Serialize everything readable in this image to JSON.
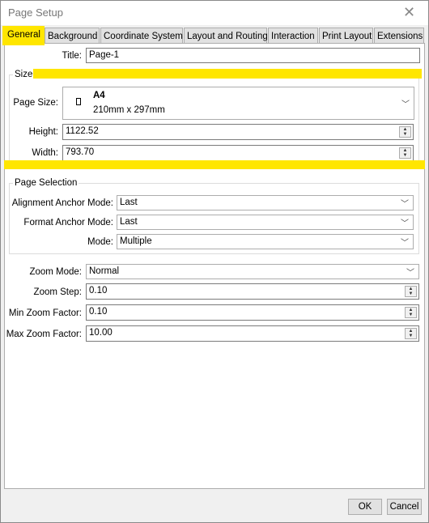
{
  "window": {
    "title": "Page Setup",
    "highlight_color": "#ffe600"
  },
  "tabs": [
    {
      "label": "General",
      "active": true
    },
    {
      "label": "Background"
    },
    {
      "label": "Coordinate System"
    },
    {
      "label": "Layout and Routing"
    },
    {
      "label": "Interaction"
    },
    {
      "label": "Print Layout"
    },
    {
      "label": "Extensions"
    }
  ],
  "general": {
    "title_label": "Title:",
    "title_value": "Page-1",
    "size": {
      "group_label": "Size",
      "page_size_label": "Page Size:",
      "page_size_name": "A4",
      "page_size_dims": "210mm x 297mm",
      "height_label": "Height:",
      "height_value": "1122.52",
      "width_label": "Width:",
      "width_value": "793.70"
    },
    "page_selection": {
      "group_label": "Page Selection",
      "alignment_label": "Alignment Anchor Mode:",
      "alignment_value": "Last",
      "format_label": "Format Anchor Mode:",
      "format_value": "Last",
      "mode_label": "Mode:",
      "mode_value": "Multiple"
    },
    "zoom": {
      "mode_label": "Zoom Mode:",
      "mode_value": "Normal",
      "step_label": "Zoom Step:",
      "step_value": "0.10",
      "min_label": "Min Zoom Factor:",
      "min_value": "0.10",
      "max_label": "Max Zoom Factor:",
      "max_value": "10.00"
    }
  },
  "buttons": {
    "ok": "OK",
    "cancel": "Cancel"
  }
}
